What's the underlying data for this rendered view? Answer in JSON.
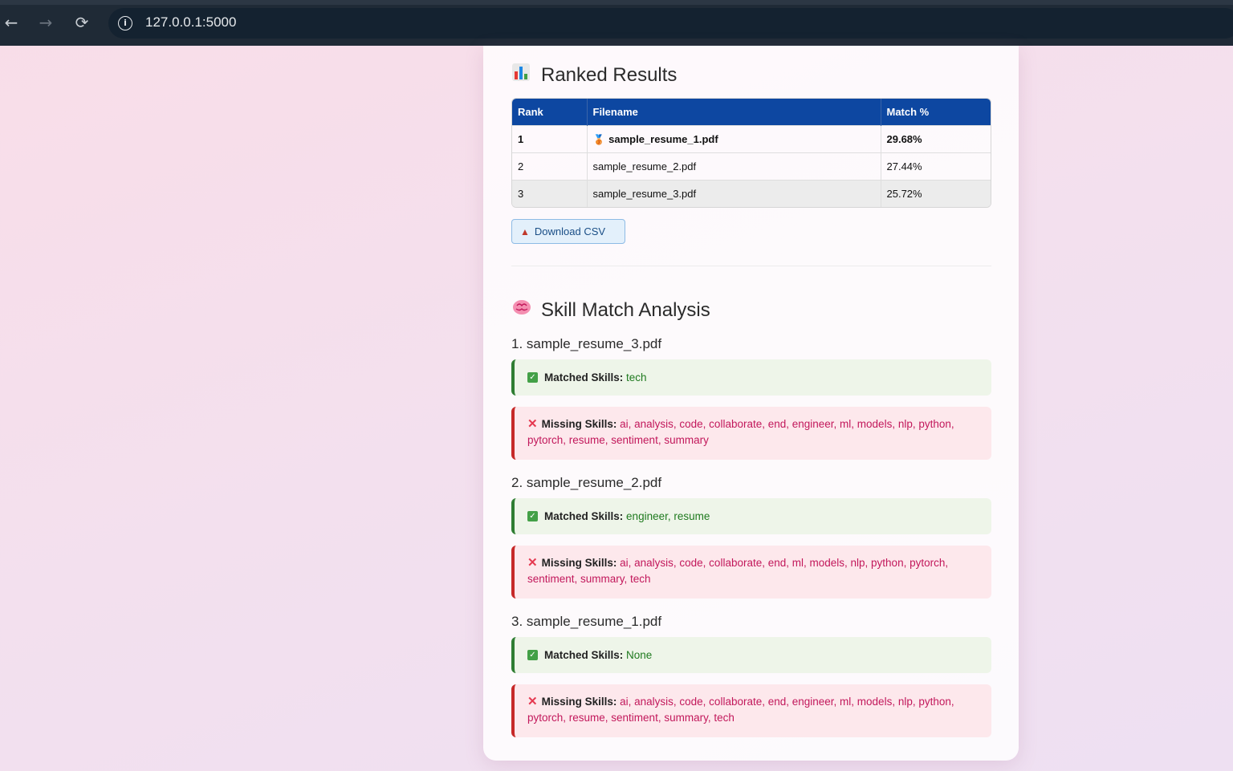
{
  "browser": {
    "url": "127.0.0.1:5000",
    "back_glyph": "←",
    "forward_glyph": "→",
    "reload_glyph": "⟳",
    "info_glyph": "i"
  },
  "ranked": {
    "title": "Ranked Results",
    "title_icon": "bar-chart-emoji",
    "headers": [
      "Rank",
      "Filename",
      "Match %"
    ],
    "rows": [
      {
        "rank": "1",
        "filename": "sample_resume_1.pdf",
        "match": "29.68%",
        "medal": "🥉"
      },
      {
        "rank": "2",
        "filename": "sample_resume_2.pdf",
        "match": "27.44%"
      },
      {
        "rank": "3",
        "filename": "sample_resume_3.pdf",
        "match": "25.72%"
      }
    ],
    "download_label": "Download CSV"
  },
  "skills": {
    "title": "Skill Match Analysis",
    "title_icon": "brain-emoji",
    "matched_label": "Matched Skills:",
    "missing_label": "Missing Skills:",
    "entries": [
      {
        "heading": "1. sample_resume_3.pdf",
        "matched": "tech",
        "missing": "ai, analysis, code, collaborate, end, engineer, ml, models, nlp, python, pytorch, resume, sentiment, summary"
      },
      {
        "heading": "2. sample_resume_2.pdf",
        "matched": "engineer, resume",
        "missing": "ai, analysis, code, collaborate, end, ml, models, nlp, python, pytorch, sentiment, summary, tech"
      },
      {
        "heading": "3. sample_resume_1.pdf",
        "matched": "None",
        "missing": "ai, analysis, code, collaborate, end, engineer, ml, models, nlp, python, pytorch, resume, sentiment, summary, tech"
      }
    ]
  },
  "colors": {
    "table_header": "#0d47a1",
    "matched_border": "#2e7d32",
    "missing_border": "#c62828",
    "matched_text": "#1f7a1f",
    "missing_text": "#c2185b"
  }
}
